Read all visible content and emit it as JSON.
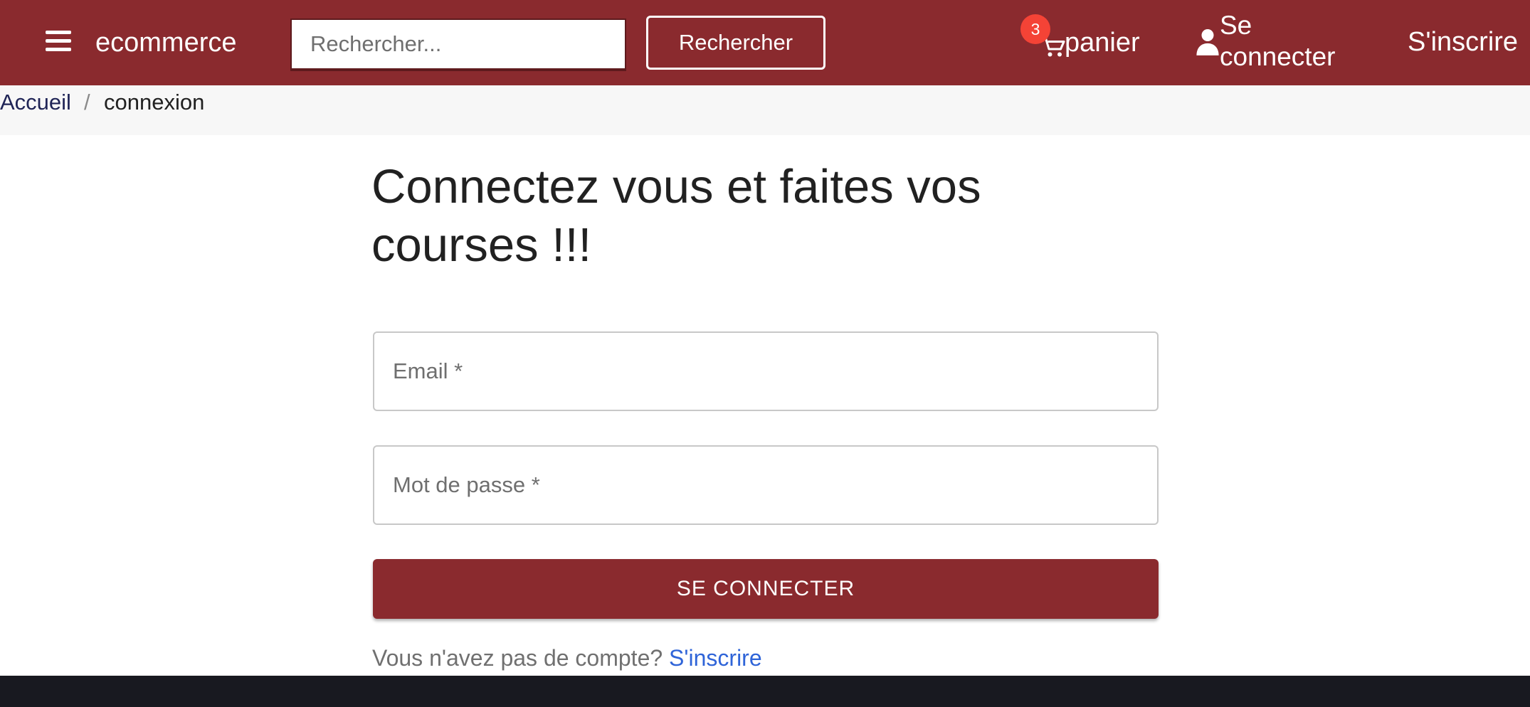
{
  "header": {
    "brand": "ecommerce",
    "search": {
      "placeholder": "Rechercher...",
      "value": "",
      "button_label": "Rechercher"
    },
    "cart": {
      "label": "panier",
      "count": "3",
      "icon": "cart-icon"
    },
    "login": {
      "label": "Se connecter",
      "icon": "user-icon"
    },
    "signup": {
      "label": "S'inscrire"
    },
    "menu_icon": "menu-icon",
    "colors": {
      "primary": "#8a2a2e",
      "badge": "#f44336"
    }
  },
  "breadcrumb": {
    "home": "Accueil",
    "separator": "/",
    "current": "connexion"
  },
  "main": {
    "title": "Connectez vous et faites vos courses !!!",
    "email": {
      "placeholder": "Email *",
      "value": ""
    },
    "password": {
      "placeholder": "Mot de passe *",
      "value": ""
    },
    "submit_label": "SE CONNECTER",
    "signup_prompt": "Vous n'avez pas de compte?",
    "signup_link": "S'inscrire",
    "link_color": "#2f64d8"
  }
}
